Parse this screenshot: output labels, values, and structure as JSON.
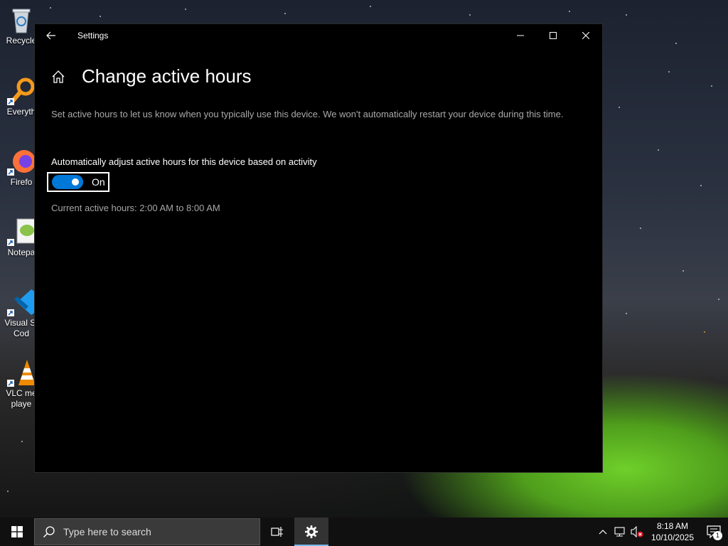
{
  "desktop": {
    "icons": [
      {
        "label": "Recycle",
        "icon": "recycle-bin-icon"
      },
      {
        "label": "Everyth",
        "icon": "everything-search-icon"
      },
      {
        "label": "Firefo",
        "icon": "firefox-icon"
      },
      {
        "label": "Notepa",
        "icon": "notepad-plus-plus-icon"
      },
      {
        "label": "Visual St",
        "label2": "Cod",
        "icon": "vscode-icon"
      },
      {
        "label": "VLC me",
        "label2": "playe",
        "icon": "vlc-icon"
      }
    ]
  },
  "window": {
    "title": "Settings",
    "page_title": "Change active hours",
    "description": "Set active hours to let us know when you typically use this device. We won't automatically restart your device during this time.",
    "toggle_label": "Automatically adjust active hours for this device based on activity",
    "toggle_state": "On",
    "toggle_on": true,
    "current_hours": "Current active hours: 2:00 AM to 8:00 AM"
  },
  "taskbar": {
    "search_placeholder": "Type here to search",
    "time": "8:18 AM",
    "date": "10/10/2025",
    "notification_count": "1"
  },
  "colors": {
    "accent": "#0078d7",
    "window_bg": "#000000",
    "taskbar_bg": "#101010"
  }
}
